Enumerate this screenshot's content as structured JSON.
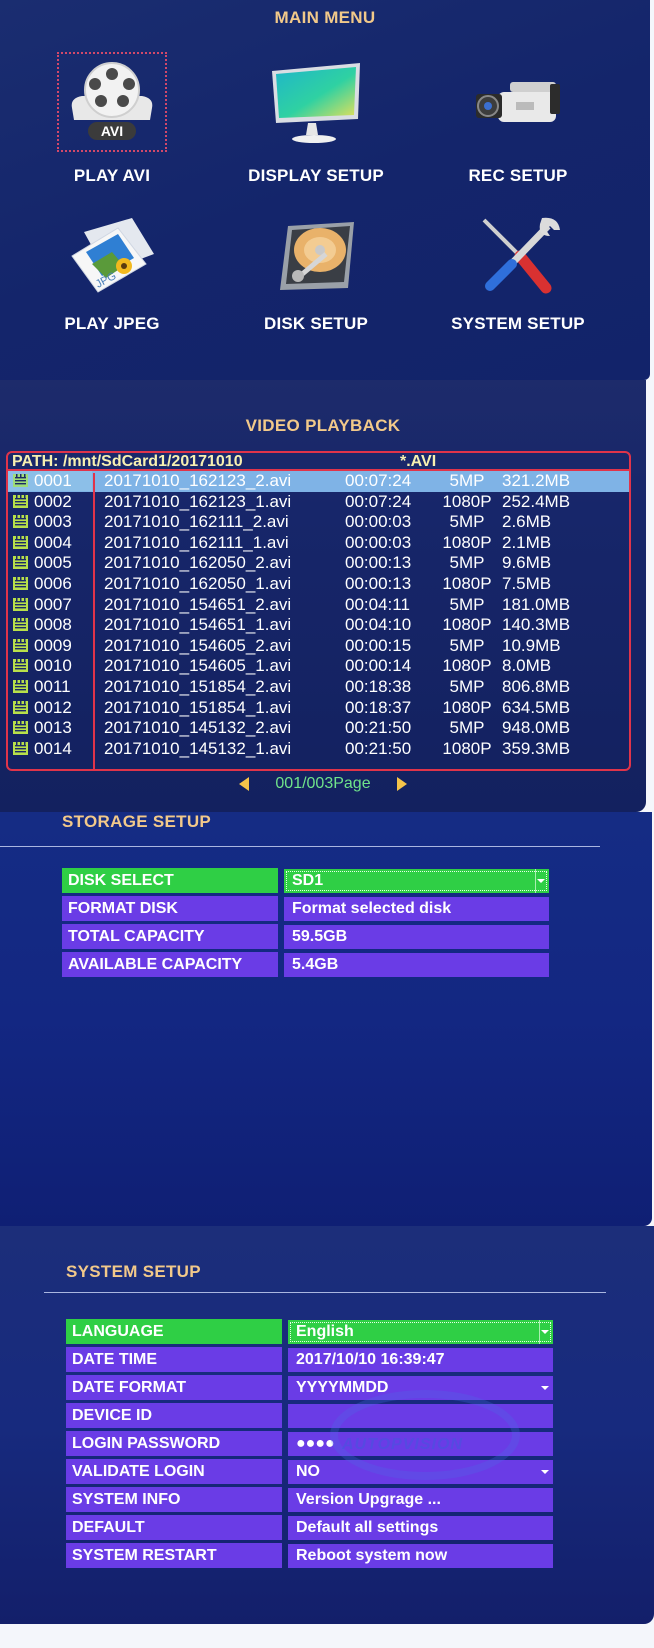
{
  "main_menu": {
    "title": "MAIN MENU",
    "items": [
      {
        "label": "PLAY AVI",
        "icon": "film-reel-avi-icon",
        "selected": true
      },
      {
        "label": "DISPLAY SETUP",
        "icon": "monitor-icon",
        "selected": false
      },
      {
        "label": "REC SETUP",
        "icon": "video-camera-icon",
        "selected": false
      },
      {
        "label": "PLAY JPEG",
        "icon": "jpg-image-icon",
        "selected": false
      },
      {
        "label": "DISK SETUP",
        "icon": "hard-disk-icon",
        "selected": false
      },
      {
        "label": "SYSTEM SETUP",
        "icon": "tools-icon",
        "selected": false
      }
    ],
    "avi_badge": "AVI",
    "jpg_badge": "JPG"
  },
  "video_playback": {
    "title": "VIDEO PLAYBACK",
    "path": "PATH: /mnt/SdCard1/20171010",
    "filter": "*.AVI",
    "files": [
      {
        "index": "0001",
        "name": "20171010_162123_2.avi",
        "duration": "00:07:24",
        "resolution": "5MP",
        "size": "321.2MB",
        "selected": true
      },
      {
        "index": "0002",
        "name": "20171010_162123_1.avi",
        "duration": "00:07:24",
        "resolution": "1080P",
        "size": "252.4MB"
      },
      {
        "index": "0003",
        "name": "20171010_162111_2.avi",
        "duration": "00:00:03",
        "resolution": "5MP",
        "size": "2.6MB"
      },
      {
        "index": "0004",
        "name": "20171010_162111_1.avi",
        "duration": "00:00:03",
        "resolution": "1080P",
        "size": "2.1MB"
      },
      {
        "index": "0005",
        "name": "20171010_162050_2.avi",
        "duration": "00:00:13",
        "resolution": "5MP",
        "size": "9.6MB"
      },
      {
        "index": "0006",
        "name": "20171010_162050_1.avi",
        "duration": "00:00:13",
        "resolution": "1080P",
        "size": "7.5MB"
      },
      {
        "index": "0007",
        "name": "20171010_154651_2.avi",
        "duration": "00:04:11",
        "resolution": "5MP",
        "size": "181.0MB"
      },
      {
        "index": "0008",
        "name": "20171010_154651_1.avi",
        "duration": "00:04:10",
        "resolution": "1080P",
        "size": "140.3MB"
      },
      {
        "index": "0009",
        "name": "20171010_154605_2.avi",
        "duration": "00:00:15",
        "resolution": "5MP",
        "size": "10.9MB"
      },
      {
        "index": "0010",
        "name": "20171010_154605_1.avi",
        "duration": "00:00:14",
        "resolution": "1080P",
        "size": "8.0MB"
      },
      {
        "index": "0011",
        "name": "20171010_151854_2.avi",
        "duration": "00:18:38",
        "resolution": "5MP",
        "size": "806.8MB"
      },
      {
        "index": "0012",
        "name": "20171010_151854_1.avi",
        "duration": "00:18:37",
        "resolution": "1080P",
        "size": "634.5MB"
      },
      {
        "index": "0013",
        "name": "20171010_145132_2.avi",
        "duration": "00:21:50",
        "resolution": "5MP",
        "size": "948.0MB"
      },
      {
        "index": "0014",
        "name": "20171010_145132_1.avi",
        "duration": "00:21:50",
        "resolution": "1080P",
        "size": "359.3MB"
      }
    ],
    "pager": {
      "label": "001/003Page",
      "current": 1,
      "total": 3
    }
  },
  "storage_setup": {
    "title": "STORAGE SETUP",
    "rows": [
      {
        "label": "DISK SELECT",
        "value": "SD1",
        "dropdown": true,
        "active": true
      },
      {
        "label": "FORMAT DISK",
        "value": "Format selected disk"
      },
      {
        "label": "TOTAL CAPACITY",
        "value": "59.5GB"
      },
      {
        "label": "AVAILABLE CAPACITY",
        "value": "5.4GB"
      }
    ]
  },
  "system_setup": {
    "title": "SYSTEM SETUP",
    "rows": [
      {
        "label": "LANGUAGE",
        "value": "English",
        "dropdown": true,
        "active": true
      },
      {
        "label": "DATE TIME",
        "value": "2017/10/10 16:39:47"
      },
      {
        "label": "DATE FORMAT",
        "value": "YYYYMMDD",
        "dropdown": true
      },
      {
        "label": "DEVICE ID",
        "value": ""
      },
      {
        "label": "LOGIN PASSWORD",
        "value": "●●●●"
      },
      {
        "label": "VALIDATE LOGIN",
        "value": "NO",
        "dropdown": true
      },
      {
        "label": "SYSTEM INFO",
        "value": "Version  Upgrage ..."
      },
      {
        "label": "DEFAULT",
        "value": "Default all settings"
      },
      {
        "label": "SYSTEM RESTART",
        "value": "Reboot system now"
      }
    ],
    "watermark": "AUTOPVISION"
  },
  "colors": {
    "background": "#14256b",
    "title": "#f2c98a",
    "field_purple": "#6a3ce6",
    "field_active_green": "#2fcf45",
    "table_border_red": "#e0344a",
    "row_selected_blue": "#7fb3e6",
    "pager_green": "#6fe38a",
    "arrow_yellow": "#f5c44a"
  }
}
